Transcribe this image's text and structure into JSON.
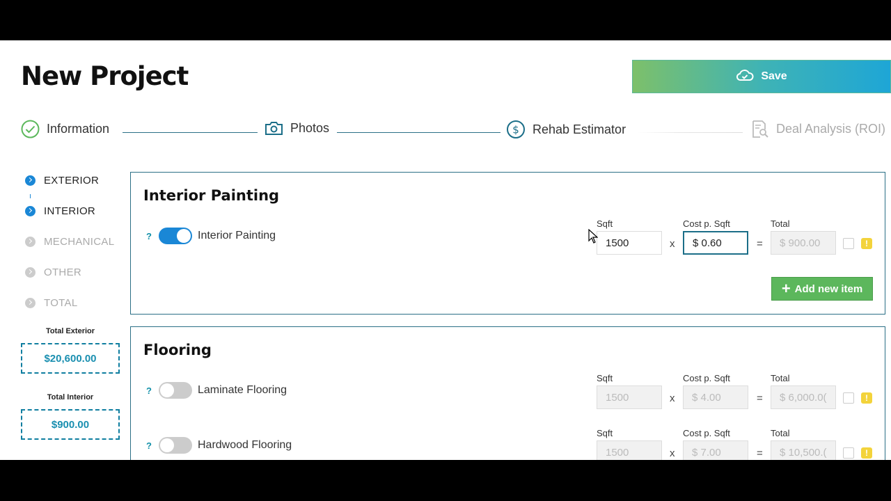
{
  "header": {
    "title": "New Project",
    "save_label": "Save"
  },
  "stepper": [
    {
      "label": "Information",
      "icon": "check-circle-icon"
    },
    {
      "label": "Photos",
      "icon": "camera-icon"
    },
    {
      "label": "Rehab Estimator",
      "icon": "dollar-circle-icon"
    },
    {
      "label": "Deal Analysis (ROI)",
      "icon": "document-search-icon"
    }
  ],
  "sidebar": {
    "items": [
      {
        "label": "EXTERIOR"
      },
      {
        "label": "INTERIOR"
      },
      {
        "label": "MECHANICAL"
      },
      {
        "label": "OTHER"
      },
      {
        "label": "TOTAL"
      }
    ],
    "total_exterior_label": "Total Exterior",
    "total_exterior_value": "$20,600.00",
    "total_interior_label": "Total Interior",
    "total_interior_value": "$900.00"
  },
  "interior_painting": {
    "title": "Interior Painting",
    "item": {
      "label": "Interior Painting",
      "help": "?",
      "sqft_label": "Sqft",
      "sqft": "1500",
      "cost_label": "Cost p. Sqft",
      "cost": "$ 0.60",
      "total_label": "Total",
      "total": "$ 900.00",
      "times": "x",
      "equals": "=",
      "info": "!"
    },
    "add_label": "Add new item"
  },
  "flooring": {
    "title": "Flooring",
    "items": [
      {
        "label": "Laminate Flooring",
        "help": "?",
        "sqft_label": "Sqft",
        "sqft": "1500",
        "cost_label": "Cost p. Sqft",
        "cost": "$ 4.00",
        "total_label": "Total",
        "total": "$ 6,000.0(",
        "times": "x",
        "equals": "=",
        "info": "!"
      },
      {
        "label": "Hardwood Flooring",
        "help": "?",
        "sqft_label": "Sqft",
        "sqft": "1500",
        "cost_label": "Cost p. Sqft",
        "cost": "$ 7.00",
        "total_label": "Total",
        "total": "$ 10,500.(",
        "times": "x",
        "equals": "=",
        "info": "!"
      }
    ]
  },
  "colors": {
    "accent_blue": "#1a87d6",
    "teal": "#2a6f86",
    "green": "#5cb75c",
    "info_yellow": "#f3d33b"
  }
}
